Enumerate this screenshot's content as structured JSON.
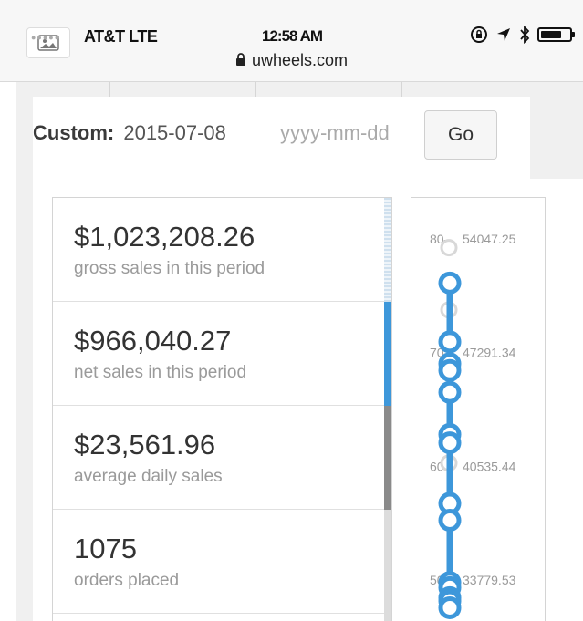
{
  "status_bar": {
    "carrier": "AT&T",
    "network": "LTE",
    "time": "12:58 AM",
    "icons": [
      "image-thumbnail-icon",
      "orientation-lock-icon",
      "location-arrow-icon",
      "bluetooth-icon",
      "battery-icon"
    ]
  },
  "browser": {
    "url": "uwheels.com",
    "secure_icon": "lock-icon"
  },
  "filter": {
    "label": "Custom:",
    "start_date": "2015-07-08",
    "end_placeholder": "yyyy-mm-dd",
    "go_label": "Go"
  },
  "stats": [
    {
      "value": "$1,023,208.26",
      "caption": "gross sales in this period"
    },
    {
      "value": "$966,040.27",
      "caption": "net sales in this period"
    },
    {
      "value": "$23,561.96",
      "caption": "average daily sales"
    },
    {
      "value": "1075",
      "caption": "orders placed"
    }
  ],
  "colors": {
    "accent": "#3d97da",
    "border": "#d4d4d4",
    "muted_text": "#9a9a9a"
  },
  "chart_data": {
    "type": "line",
    "y_ticks_left": [
      "80",
      "70",
      "60",
      "50"
    ],
    "y_ticks_right": [
      "54047.25",
      "47291.34",
      "40535.44",
      "33779.53"
    ],
    "series": [
      {
        "values": [
          51700,
          48200,
          46900,
          46500,
          45200,
          42700,
          42200,
          38600,
          37600,
          33900,
          33600,
          33000,
          32800,
          32400
        ]
      }
    ],
    "ghost_points": [
      53800,
      50100,
      41000,
      32700
    ],
    "ylim": [
      31000,
      55500
    ]
  }
}
